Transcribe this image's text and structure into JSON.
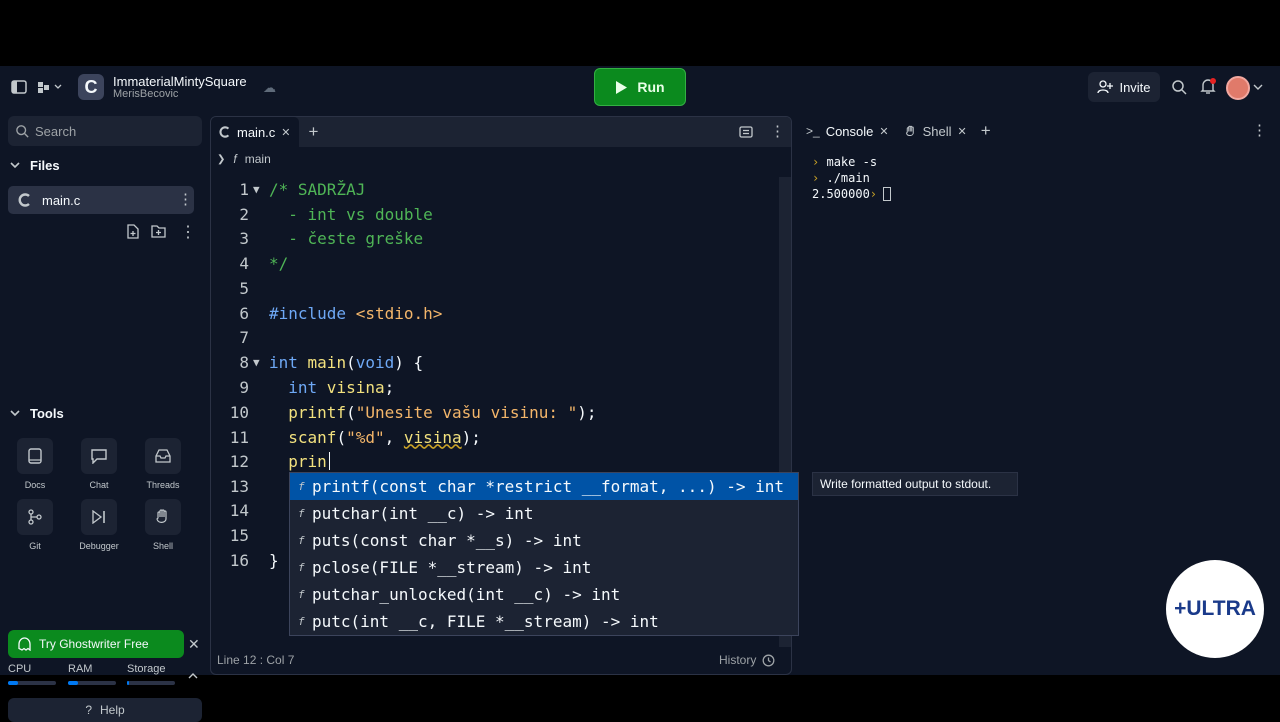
{
  "repl": {
    "name": "ImmaterialMintySquare",
    "owner": "MerisBecovic"
  },
  "topbar": {
    "run_label": "Run",
    "invite_label": "Invite"
  },
  "sidebar": {
    "search_placeholder": "Search",
    "files_title": "Files",
    "files": [
      {
        "name": "main.c"
      }
    ],
    "tools_title": "Tools",
    "tools": [
      {
        "label": "Docs"
      },
      {
        "label": "Chat"
      },
      {
        "label": "Threads"
      },
      {
        "label": "Git"
      },
      {
        "label": "Debugger"
      },
      {
        "label": "Shell"
      }
    ],
    "ghostwriter_label": "Try Ghostwriter Free",
    "resources": [
      {
        "label": "CPU",
        "level": 0.2
      },
      {
        "label": "RAM",
        "level": 0.2
      },
      {
        "label": "Storage",
        "level": 0.05
      }
    ],
    "help_label": "Help"
  },
  "editor": {
    "tab": "main.c",
    "breadcrumb": "main",
    "status_position": "Line 12 : Col 7",
    "history_label": "History",
    "line_numbers": [
      "1",
      "2",
      "3",
      "4",
      "5",
      "6",
      "7",
      "8",
      "9",
      "10",
      "11",
      "12",
      "13",
      "14",
      "15",
      "16"
    ],
    "lines": {
      "l1": "/* SADRŽAJ",
      "l2": "  - int vs double",
      "l3": "  - česte greške",
      "l4": "*/",
      "l6a": "#include",
      "l6b": " <stdio.h>",
      "l8a": "int",
      "l8b": " main",
      "l8c": "(",
      "l8d": "void",
      "l8e": ") {",
      "l9a": "  int",
      "l9b": " visina",
      "l9c": ";",
      "l10a": "  printf",
      "l10b": "(",
      "l10c": "\"Unesite vašu visinu: \"",
      "l10d": ");",
      "l11a": "  scanf",
      "l11b": "(",
      "l11c": "\"%d\"",
      "l11d": ", ",
      "l11e": "visina",
      "l11f": ");",
      "l12": "  prin",
      "l16": "}"
    }
  },
  "autocomplete": {
    "items": [
      "printf(const char *restrict __format, ...) -> int",
      "putchar(int __c) -> int",
      "puts(const char *__s) -> int",
      "pclose(FILE *__stream) -> int",
      "putchar_unlocked(int __c) -> int",
      "putc(int __c, FILE *__stream) -> int"
    ],
    "tooltip": "Write formatted output to stdout."
  },
  "console": {
    "tabs": [
      "Console",
      "Shell"
    ],
    "lines": [
      "make -s",
      "./main"
    ],
    "output": "2.500000"
  },
  "watermark": "+ULTRA"
}
